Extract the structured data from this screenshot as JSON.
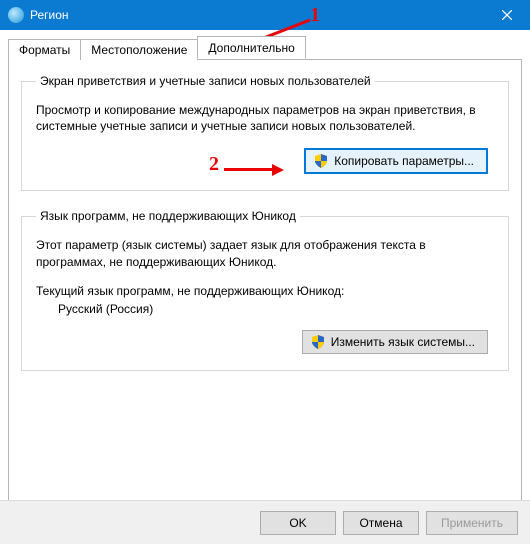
{
  "window": {
    "title": "Регион"
  },
  "tabs": {
    "items": [
      {
        "label": "Форматы"
      },
      {
        "label": "Местоположение"
      },
      {
        "label": "Дополнительно"
      }
    ]
  },
  "group1": {
    "legend": "Экран приветствия и учетные записи новых пользователей",
    "desc": "Просмотр и копирование международных параметров на экран приветствия, в системные учетные записи и учетные записи новых пользователей.",
    "button": "Копировать параметры..."
  },
  "group2": {
    "legend": "Язык программ, не поддерживающих Юникод",
    "desc": "Этот параметр (язык системы) задает язык для отображения текста в программах, не поддерживающих Юникод.",
    "current_label": "Текущий язык программ, не поддерживающих Юникод:",
    "current_value": "Русский (Россия)",
    "button": "Изменить язык системы..."
  },
  "buttons": {
    "ok": "OK",
    "cancel": "Отмена",
    "apply": "Применить"
  },
  "annotations": {
    "n1": "1",
    "n2": "2"
  }
}
